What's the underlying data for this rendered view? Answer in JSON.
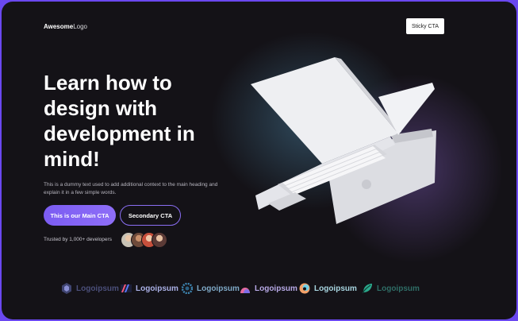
{
  "nav": {
    "logo_bold": "Awesome",
    "logo_rest": "Logo",
    "sticky_cta": "Sticky CTA"
  },
  "hero": {
    "headline": "Learn how to design with development in mind!",
    "subtext": "This is a dummy text used to add additional context to the main heading and explain it in a few simple words.",
    "main_cta": "This is our Main CTA",
    "secondary_cta": "Secondary CTA",
    "trusted_text": "Trusted by 1,000+ developers"
  },
  "colors": {
    "accent": "#7b5cf2",
    "background": "#141217",
    "frame": "#6a48f0"
  },
  "logos": [
    {
      "name": "Logoipsum",
      "icon": "hexagon-logo-icon",
      "color": "#4b4f7a"
    },
    {
      "name": "Logoipsum",
      "icon": "stripes-logo-icon",
      "color": "#aab0e6"
    },
    {
      "name": "Logoipsum",
      "icon": "gear-ring-logo-icon",
      "color": "#7fa9c7"
    },
    {
      "name": "Logoipsum",
      "icon": "arch-logo-icon",
      "color": "#b7a9e6"
    },
    {
      "name": "Logoipsum",
      "icon": "swirl-logo-icon",
      "color": "#a8d5e0"
    },
    {
      "name": "Logoipsum",
      "icon": "leaf-logo-icon",
      "color": "#2f6d66"
    }
  ]
}
